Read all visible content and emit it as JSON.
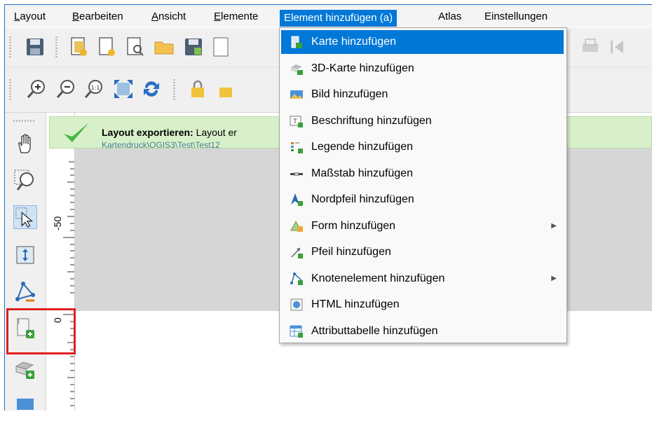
{
  "menubar": {
    "items": [
      "Layout",
      "Bearbeiten",
      "Ansicht",
      "Elemente",
      "Element hinzufügen (a)",
      "Atlas",
      "Einstellungen"
    ]
  },
  "notification": {
    "title": "Layout exportieren:",
    "text": "Layout er",
    "path": "Kartendruck\\QGIS3\\Test\\Test12"
  },
  "ruler": {
    "label_minus50": "-50",
    "label_0": "0"
  },
  "dropdown": {
    "items": [
      {
        "label": "Karte hinzufügen",
        "icon": "map-icon",
        "highlighted": true
      },
      {
        "label": "3D-Karte hinzufügen",
        "icon": "3d-map-icon"
      },
      {
        "label": "Bild hinzufügen",
        "icon": "picture-icon"
      },
      {
        "label": "Beschriftung hinzufügen",
        "icon": "label-icon"
      },
      {
        "label": "Legende hinzufügen",
        "icon": "legend-icon"
      },
      {
        "label": "Maßstab hinzufügen",
        "icon": "scalebar-icon"
      },
      {
        "label": "Nordpfeil hinzufügen",
        "icon": "north-arrow-icon"
      },
      {
        "label": "Form hinzufügen",
        "icon": "shape-icon",
        "submenu": true
      },
      {
        "label": "Pfeil hinzufügen",
        "icon": "arrow-icon"
      },
      {
        "label": "Knotenelement hinzufügen",
        "icon": "node-item-icon",
        "submenu": true
      },
      {
        "label": "HTML hinzufügen",
        "icon": "html-icon"
      },
      {
        "label": "Attributtabelle hinzufügen",
        "icon": "attribute-table-icon"
      }
    ]
  },
  "colors": {
    "accent": "#0078d7",
    "highlight_box": "#e02020",
    "message_bg": "#d8f0c9"
  }
}
